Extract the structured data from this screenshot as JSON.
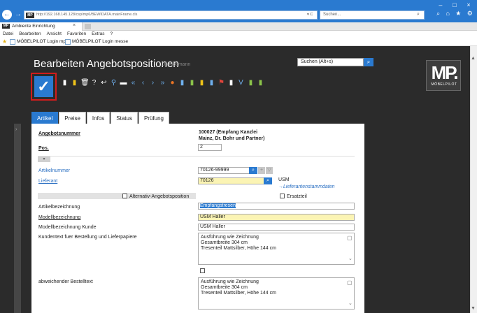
{
  "browser": {
    "url": "http://192.168.145.128/csp/mp6/BEWIDATA.mainFrame.cls",
    "addr_controls": "▾ C",
    "search_placeholder": "Suchen...",
    "tab_title": "Ambiente Einrichtung",
    "tab_close": "×",
    "favicon_text": "MP",
    "menu": [
      "Datei",
      "Bearbeiten",
      "Ansicht",
      "Favoriten",
      "Extras",
      "?"
    ],
    "favorites": [
      "MÖBELPILOT Login mp6",
      "MÖBELPILOT Login messe"
    ],
    "window_controls": [
      "–",
      "□",
      "×"
    ],
    "toolbar_icons": [
      "⌕",
      "⌂",
      "★",
      "⚙"
    ]
  },
  "app": {
    "title": "Bearbeiten Angebotspositionen",
    "user": "Uli Flottmann",
    "search_value": "Suchen (Alt+s)",
    "search_icon": "search-icon",
    "logo_text": "MP.",
    "logo_sub": "MÖBELPILOT",
    "save_glyph": "✓",
    "toolbar": [
      {
        "glyph": "▮",
        "name": "new-doc-icon",
        "color": "#ffffff"
      },
      {
        "glyph": "▮",
        "name": "notes-icon",
        "color": "#f0c419"
      },
      {
        "glyph": "🗑",
        "name": "trash-icon",
        "color": "#ffffff"
      },
      {
        "glyph": "?",
        "name": "help-icon",
        "color": "#ffffff"
      },
      {
        "glyph": "↩",
        "name": "undo-icon",
        "color": "#ffffff"
      },
      {
        "glyph": "⚲",
        "name": "search-doc-icon",
        "color": "#6fb0ee"
      },
      {
        "glyph": "▬",
        "name": "print-icon",
        "color": "#ffffff"
      },
      {
        "glyph": "«",
        "name": "first-icon",
        "color": "#6fb0ee"
      },
      {
        "glyph": "‹",
        "name": "prev-icon",
        "color": "#6fb0ee"
      },
      {
        "glyph": "›",
        "name": "next-icon",
        "color": "#6fb0ee"
      },
      {
        "glyph": "»",
        "name": "last-icon",
        "color": "#6fb0ee"
      },
      {
        "glyph": "●",
        "name": "tags-icon",
        "color": "#e97424"
      },
      {
        "glyph": "▮",
        "name": "docs-icon",
        "color": "#6fb0ee"
      },
      {
        "glyph": "▮",
        "name": "user-doc-icon",
        "color": "#8bc34a"
      },
      {
        "glyph": "▮",
        "name": "folder-icon",
        "color": "#f0c419"
      },
      {
        "glyph": "▮",
        "name": "doc-edit-icon",
        "color": "#6fb0ee"
      },
      {
        "glyph": "⚑",
        "name": "flag-icon",
        "color": "#e0453b"
      },
      {
        "glyph": "▮",
        "name": "copy-icon",
        "color": "#ffffff"
      },
      {
        "glyph": "V",
        "name": "v-icon",
        "color": "#6fb0ee"
      },
      {
        "glyph": "▮",
        "name": "excel-icon",
        "color": "#8bc34a"
      },
      {
        "glyph": "▮",
        "name": "image-icon",
        "color": "#8bc34a"
      }
    ]
  },
  "tabs": [
    {
      "label": "Artikel",
      "active": true
    },
    {
      "label": "Preise",
      "active": false
    },
    {
      "label": "Infos",
      "active": false
    },
    {
      "label": "Status",
      "active": false
    },
    {
      "label": "Prüfung",
      "active": false
    }
  ],
  "form": {
    "angebotsnummer_label": "Angebotsnummer",
    "angebotsnummer_value": "100027 (Empfang Kanzlei",
    "angebotsnummer_value2": "Mainz, Dr. Bohr und Partner)",
    "pos_label": "Pos.",
    "pos_value": "2",
    "artikelnummer_label": "Artikelnummer",
    "artikelnummer_value": "70126-99999",
    "lieferant_label": "Lieferant",
    "lieferant_value": "70126",
    "lieferant_name": "USM",
    "lieferant_link": "→Lieferantenstammdaten",
    "ersatzteil_label": "Ersatzteil",
    "alternativ_label": "Alternativ-Angebotsposition",
    "artikelbezeichnung_label": "Artikelbezeichnung",
    "artikelbezeichnung_value": "Empfangstresen",
    "modellbezeichnung_label": "Modellbezeichnung",
    "modellbezeichnung_value": "USM Haller",
    "modellkunde_label": "Modellbezeichnung Kunde",
    "modellkunde_value": "USM Haller",
    "kundentext_label": "Kundentext fuer Bestellung und Lieferpapiere",
    "kundentext_value": "Ausführung wie Zeichnung\nGesamtbreite 304 cm\nTresenteil Mattsilber, Höhe 144 cm",
    "bestelltext_label": "abweichender Bestelltext",
    "bestelltext_value": "Ausführung wie Zeichnung\nGesamtbreite 304 cm\nTresenteil Mattsilber, Höhe 144 cm"
  }
}
